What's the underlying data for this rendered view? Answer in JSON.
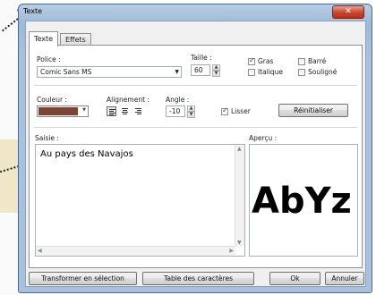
{
  "window": {
    "title": "Texte",
    "close_label": "✕"
  },
  "tabs": [
    {
      "label": "Texte"
    },
    {
      "label": "Effets"
    }
  ],
  "font": {
    "label": "Police :",
    "value": "Comic Sans MS"
  },
  "size": {
    "label": "Taille :",
    "value": "60"
  },
  "styles": {
    "bold": {
      "label": "Gras",
      "checked": true
    },
    "strike": {
      "label": "Barré",
      "checked": false
    },
    "italic": {
      "label": "Italique",
      "checked": false
    },
    "underline": {
      "label": "Souligné",
      "checked": false
    }
  },
  "color": {
    "label": "Couleur :",
    "value": "#7a4535"
  },
  "alignment": {
    "label": "Alignement :",
    "selected": "left"
  },
  "angle": {
    "label": "Angle :",
    "value": "-10"
  },
  "smooth": {
    "label": "Lisser",
    "checked": true
  },
  "reset_button": "Réinitialiser",
  "input": {
    "label": "Saisie :",
    "value": "Au pays des Navajos"
  },
  "preview": {
    "label": "Aperçu :",
    "text": "AbYz"
  },
  "footer": {
    "transform_button": "Transformer en sélection",
    "charmap_button": "Table des caractères",
    "ok_button": "Ok",
    "cancel_button": "Annuler"
  }
}
